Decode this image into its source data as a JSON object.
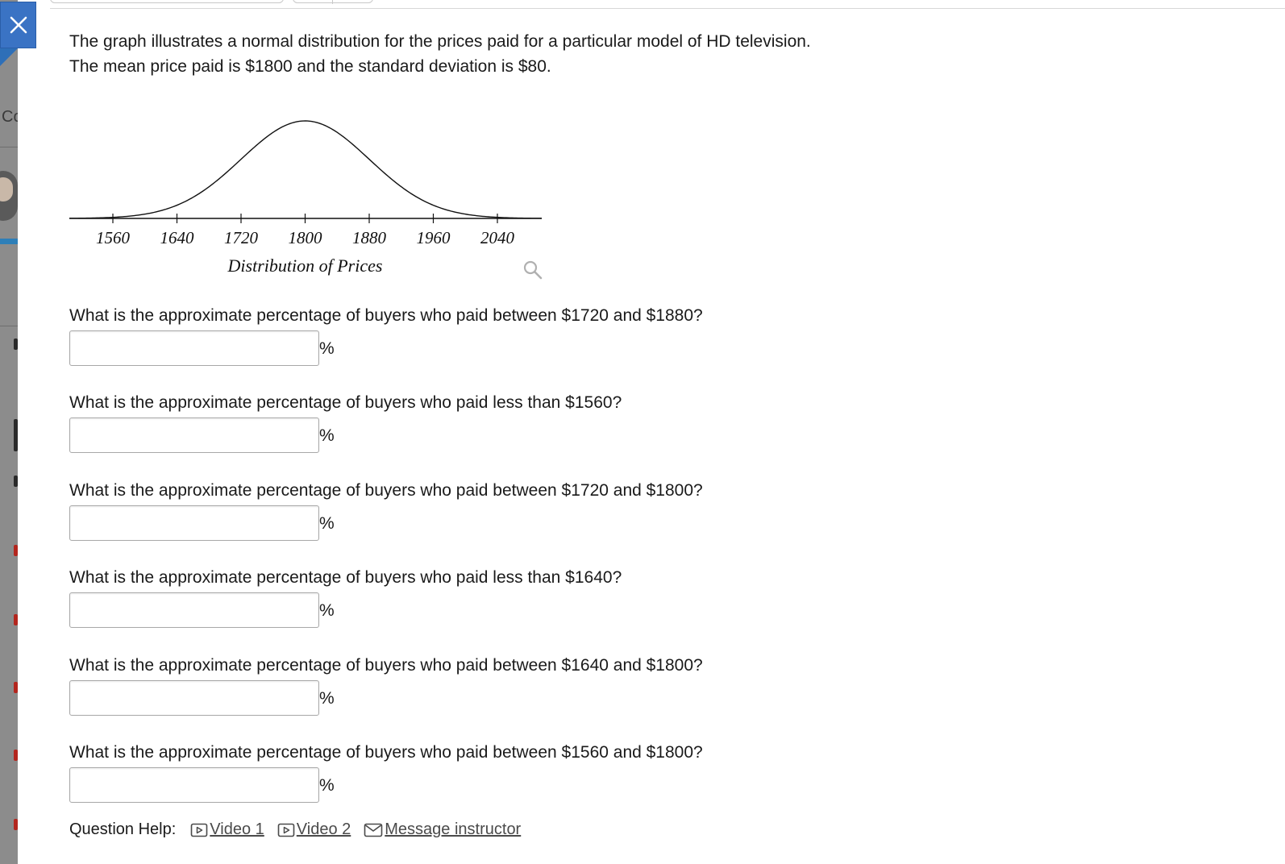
{
  "background": {
    "partial_text": "Co"
  },
  "close_button": {
    "icon": "close-icon"
  },
  "intro": {
    "line1": "The graph illustrates a normal distribution for the prices paid for a particular model of HD television.",
    "line2": "The mean price paid is $1800 and the standard deviation is $80."
  },
  "chart_data": {
    "type": "line",
    "curve": "normal",
    "mean": 1800,
    "sd": 80,
    "ticks": [
      "1560",
      "1640",
      "1720",
      "1800",
      "1880",
      "1960",
      "2040"
    ],
    "xlabel": "Distribution of Prices"
  },
  "zoom": {
    "icon": "magnifier-icon"
  },
  "questions": [
    {
      "text": "What is the approximate percentage of buyers who paid between $1720 and $1880?",
      "value": "",
      "unit": "%"
    },
    {
      "text": "What is the approximate percentage of buyers who paid less than $1560?",
      "value": "",
      "unit": "%"
    },
    {
      "text": "What is the approximate percentage of buyers who paid between $1720 and $1800?",
      "value": "",
      "unit": "%"
    },
    {
      "text": "What is the approximate percentage of buyers who paid less than $1640?",
      "value": "",
      "unit": "%"
    },
    {
      "text": "What is the approximate percentage of buyers who paid between $1640 and $1800?",
      "value": "",
      "unit": "%"
    },
    {
      "text": "What is the approximate percentage of buyers who paid between $1560 and $1800?",
      "value": "",
      "unit": "%"
    }
  ],
  "help": {
    "label": "Question Help:",
    "video1": "Video 1",
    "video2": "Video 2",
    "message": "Message instructor"
  }
}
